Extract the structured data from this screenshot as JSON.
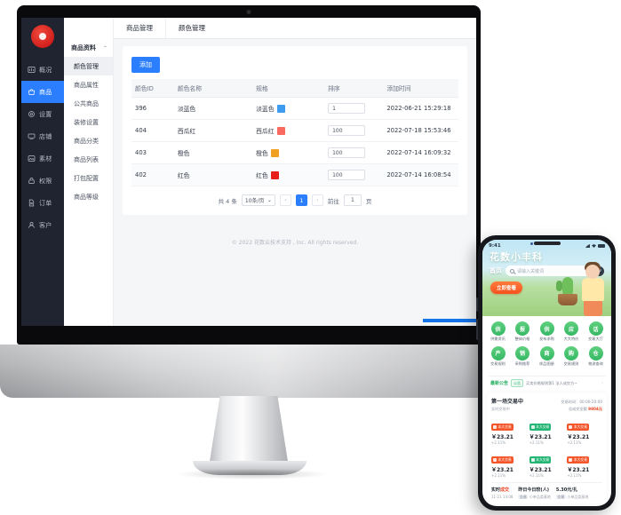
{
  "desktop": {
    "brand": {
      "logo_name": "flower-logo"
    },
    "sidebar": {
      "items": [
        {
          "label": "概况",
          "icon": "dashboard-icon",
          "active": false
        },
        {
          "label": "商品",
          "icon": "product-icon",
          "active": true
        },
        {
          "label": "设置",
          "icon": "settings-icon",
          "active": false
        },
        {
          "label": "店铺",
          "icon": "shop-icon",
          "active": false
        },
        {
          "label": "素材",
          "icon": "material-icon",
          "active": false
        },
        {
          "label": "权限",
          "icon": "permission-icon",
          "active": false
        },
        {
          "label": "订单",
          "icon": "order-icon",
          "active": false
        },
        {
          "label": "客户",
          "icon": "customer-icon",
          "active": false
        }
      ]
    },
    "submenu": {
      "group_label": "商品资料",
      "caret": "⌃",
      "items": [
        {
          "label": "颜色管理",
          "active": true
        },
        {
          "label": "商品属性",
          "active": false
        },
        {
          "label": "公共商品",
          "active": false
        },
        {
          "label": "装修设置",
          "active": false
        },
        {
          "label": "商品分类",
          "active": false
        },
        {
          "label": "商品列表",
          "active": false
        },
        {
          "label": "打包配置",
          "active": false
        },
        {
          "label": "商品等级",
          "active": false
        }
      ]
    },
    "tabs": [
      {
        "label": "商品管理",
        "active": false
      },
      {
        "label": "颜色管理",
        "active": true
      }
    ],
    "toolbar": {
      "add_label": "添加",
      "accent_color": "#2b7fff"
    },
    "table": {
      "headers": [
        "颜色ID",
        "颜色名称",
        "规格",
        "排序",
        "添加时间"
      ],
      "rows": [
        {
          "id": "396",
          "name": "淡蓝色",
          "spec": "淡蓝色",
          "color": "#3d9bf0",
          "sort": "1",
          "created": "2022-06-21 15:29:18"
        },
        {
          "id": "404",
          "name": "西瓜红",
          "spec": "西瓜红",
          "color": "#fb6a60",
          "sort": "100",
          "created": "2022-07-18 15:53:46"
        },
        {
          "id": "403",
          "name": "橙色",
          "spec": "橙色",
          "color": "#f0a020",
          "sort": "100",
          "created": "2022-07-14 16:09:32"
        },
        {
          "id": "402",
          "name": "红色",
          "spec": "红色",
          "color": "#e8201a",
          "sort": "100",
          "created": "2022-07-14 16:08:54"
        }
      ]
    },
    "pagination": {
      "total_text": "共 4 条",
      "page_size": "10条/页",
      "prev": "‹",
      "next": "›",
      "current_page": "1",
      "jump_label": "前往",
      "jump_value": "1",
      "jump_unit": "页"
    },
    "footer": "© 2022 花数云技术支持 , Inc. All rights reserved."
  },
  "phone": {
    "status": {
      "time": "9:41"
    },
    "hero": {
      "title": "花数小丰科",
      "home_label": "首页",
      "search_placeholder": "请输入关键词",
      "scan_icon": "scan-icon",
      "cta": "立即查看"
    },
    "icon_grid": [
      [
        {
          "glyph": "供",
          "label": "供需资讯"
        },
        {
          "glyph": "报",
          "label": "整体价格"
        },
        {
          "glyph": "供",
          "label": "发布求购"
        },
        {
          "glyph": "应",
          "label": "大大特价"
        },
        {
          "glyph": "话",
          "label": "交易大厅"
        }
      ],
      [
        {
          "glyph": "产",
          "label": "交易规则"
        },
        {
          "glyph": "销",
          "label": "采购推荐"
        },
        {
          "glyph": "商",
          "label": "样品图册"
        },
        {
          "glyph": "购",
          "label": "交易规则"
        },
        {
          "glyph": "仓",
          "label": "物流查询"
        }
      ]
    ],
    "notice": {
      "head": "最新公告",
      "tag": "公告",
      "message": "买卖价格规则第1 法人成交方~",
      "arrow": "›"
    },
    "market": {
      "title": "第一场交易中",
      "time_label": "交易时间：00:00-20:00",
      "sub_left": "实时交易中",
      "sub_right_label": "总成交金额",
      "sub_right_value": "9804元",
      "cells": [
        {
          "pill": "本大交易",
          "dir": "up",
          "price": "￥23.21",
          "chg": "+2.11%"
        },
        {
          "pill": "本大交易",
          "dir": "down",
          "price": "￥23.21",
          "chg": "+2.11%"
        },
        {
          "pill": "本大交易",
          "dir": "up",
          "price": "￥23.21",
          "chg": "+2.11%"
        },
        {
          "pill": "本大交易",
          "dir": "up",
          "price": "￥23.21",
          "chg": "+2.11%"
        },
        {
          "pill": "本大交易",
          "dir": "down",
          "price": "￥23.21",
          "chg": "+2.11%"
        },
        {
          "pill": "本大交易",
          "dir": "up",
          "price": "￥23.21",
          "chg": "+2.11%"
        }
      ],
      "deal": {
        "label_a": "实时",
        "label_b": "成交",
        "time": "11-21 14:08",
        "col2_title": "昨日今日较(人)",
        "col2_badge": "交易",
        "col2_text": "小单品类基地",
        "col3_title": "5.30元/扎",
        "col3_badge": "交易",
        "col3_text": "小单品类基地"
      }
    }
  }
}
